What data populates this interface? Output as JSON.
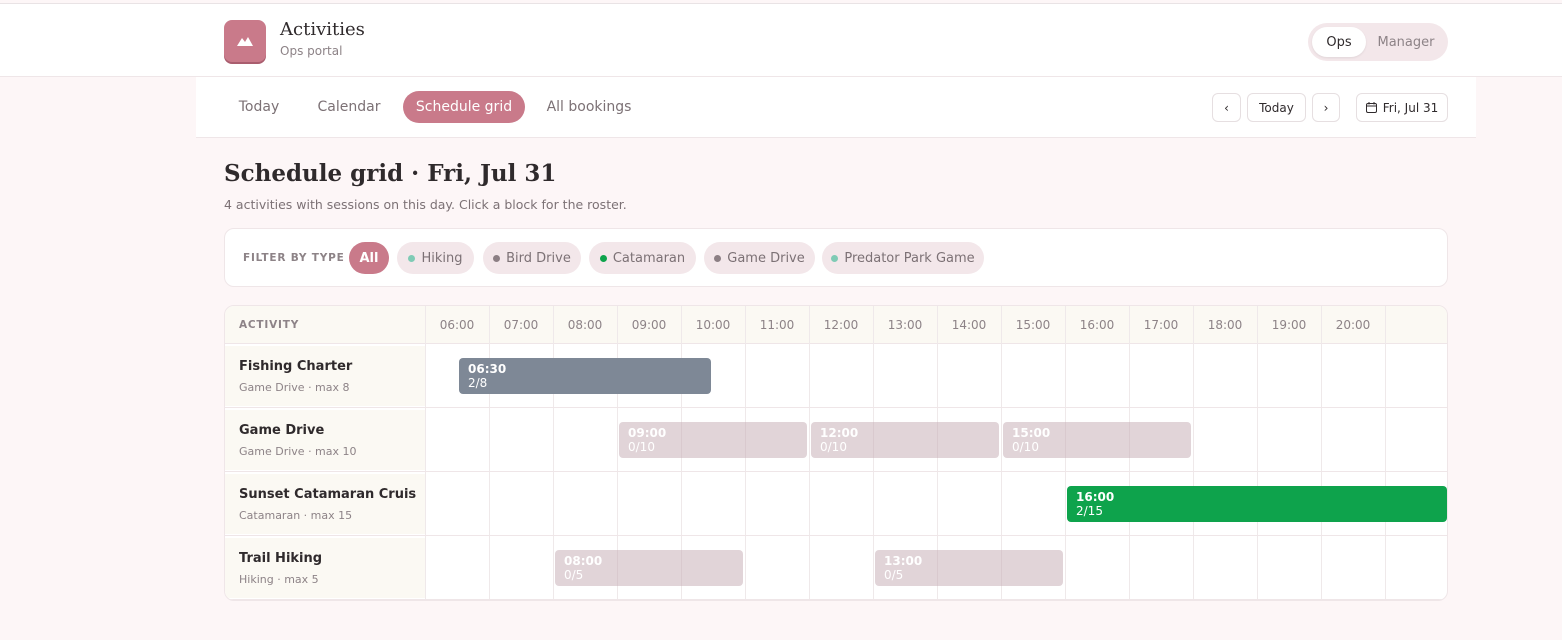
{
  "app": {
    "title": "Activities",
    "subtitle": "Ops portal"
  },
  "roles": {
    "ops": "Ops",
    "manager": "Manager",
    "selected": "Ops"
  },
  "nav": {
    "tabs": [
      "Today",
      "Calendar",
      "Schedule grid",
      "All bookings"
    ],
    "active_tab": "Schedule grid",
    "prev": "‹",
    "today": "Today",
    "next": "›",
    "date": "Fri, Jul 31"
  },
  "page": {
    "title": "Schedule grid · Fri, Jul 31",
    "subtitle": "4 activities with sessions on this day. Click a block for the roster."
  },
  "filter": {
    "label": "FILTER BY TYPE",
    "chips": [
      {
        "label": "All",
        "active": true
      },
      {
        "label": "Hiking",
        "dot_color": "#7fcbb5"
      },
      {
        "label": "Bird Drive",
        "dot_color": "#8c7f84"
      },
      {
        "label": "Catamaran",
        "dot_color": "#0ea34c"
      },
      {
        "label": "Game Drive",
        "dot_color": "#8c7f84"
      },
      {
        "label": "Predator Park Game",
        "dot_color": "#7fcbb5"
      }
    ]
  },
  "grid": {
    "header": "ACTIVITY",
    "hours": [
      "06:00",
      "07:00",
      "08:00",
      "09:00",
      "10:00",
      "11:00",
      "12:00",
      "13:00",
      "14:00",
      "15:00",
      "16:00",
      "17:00",
      "18:00",
      "19:00",
      "20:00"
    ],
    "rows": [
      {
        "name": "Fishing Charter",
        "meta": "Game Drive · max 8",
        "sessions": [
          {
            "time": "06:30",
            "count": "2/8",
            "style": "grey"
          }
        ]
      },
      {
        "name": "Game Drive",
        "meta": "Game Drive · max 10",
        "sessions": [
          {
            "time": "09:00",
            "count": "0/10",
            "style": "muted"
          },
          {
            "time": "12:00",
            "count": "0/10",
            "style": "muted"
          },
          {
            "time": "15:00",
            "count": "0/10",
            "style": "muted"
          }
        ]
      },
      {
        "name": "Sunset Catamaran Cruis",
        "meta": "Catamaran · max 15",
        "sessions": [
          {
            "time": "16:00",
            "count": "2/15",
            "style": "green"
          }
        ]
      },
      {
        "name": "Trail Hiking",
        "meta": "Hiking · max 5",
        "sessions": [
          {
            "time": "08:00",
            "count": "0/5",
            "style": "muted"
          },
          {
            "time": "13:00",
            "count": "0/5",
            "style": "muted"
          }
        ]
      }
    ]
  },
  "colors": {
    "accent": "#c97a8a",
    "catamaran": "#0ea34c",
    "session_grey": "#7e8896",
    "page_bg": "#fdf6f7"
  }
}
